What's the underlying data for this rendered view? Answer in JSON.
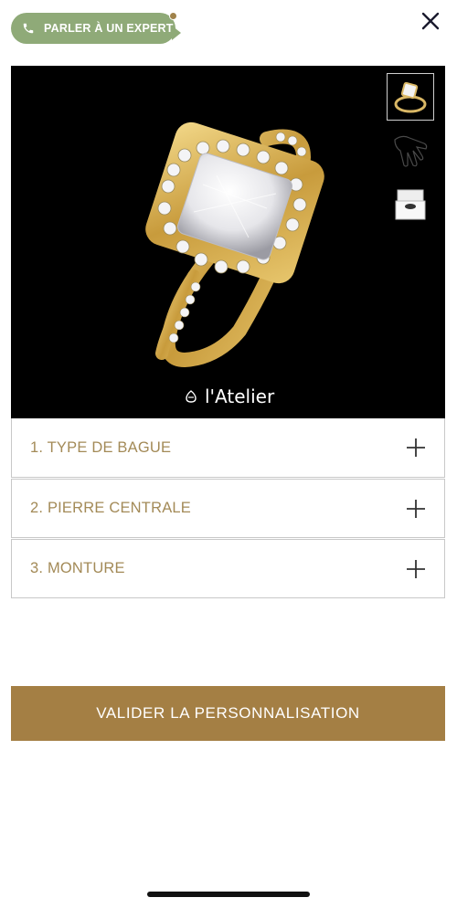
{
  "header": {
    "expert_label": "PARLER À UN EXPERT"
  },
  "viewer": {
    "brand_text": "l'Atelier",
    "thumbnails": [
      "ring-thumbnail",
      "hand-thumbnail",
      "box-thumbnail"
    ]
  },
  "accordion": {
    "items": [
      {
        "label": "1. TYPE DE BAGUE"
      },
      {
        "label": "2. PIERRE CENTRALE"
      },
      {
        "label": "3. MONTURE"
      }
    ]
  },
  "cta": {
    "label": "VALIDER LA PERSONNALISATION"
  },
  "colors": {
    "expert_green": "#8faa78",
    "gold": "#a47f44",
    "label_gold": "#a38a57"
  }
}
